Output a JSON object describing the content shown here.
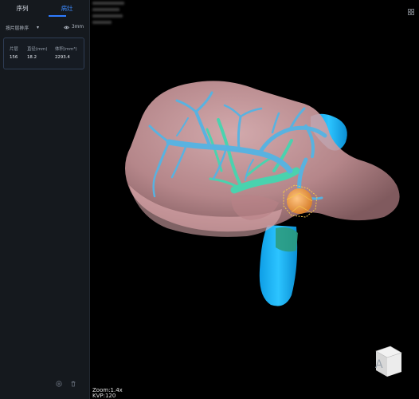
{
  "tabs": [
    {
      "label": "序列",
      "active": false
    },
    {
      "label": "病灶",
      "active": true
    }
  ],
  "toolbar": {
    "sort_label": "按片层排序",
    "thickness_label": "3mm"
  },
  "lesion_table": {
    "headers": [
      "片层",
      "直径(mm)",
      "体积(mm³)"
    ],
    "rows": [
      [
        "156",
        "18.2",
        "2293.4"
      ]
    ]
  },
  "viewport": {
    "zoom_label": "Zoom:1.4x",
    "kvp_label": "KVP:120",
    "orientation_letter": "A"
  },
  "colors": {
    "accent": "#2f7bff",
    "liver": "#e0a6aa",
    "vessel_portal": "#4fb3e0",
    "vessel_hepatic": "#45d6b0",
    "vena_cava": "#16b8ff",
    "tumor": "#f0a85a"
  }
}
